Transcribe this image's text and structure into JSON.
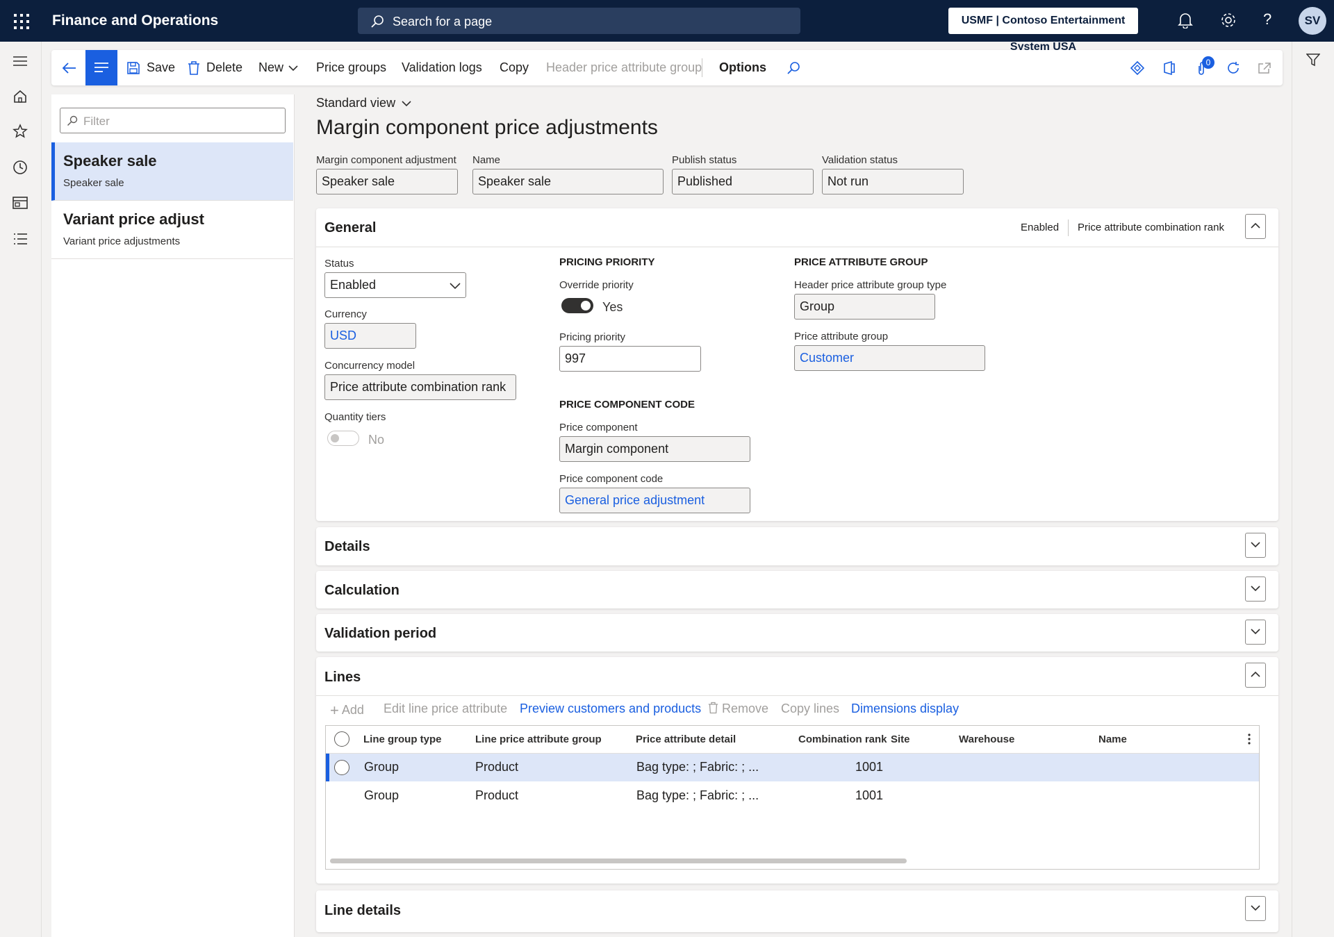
{
  "topbar": {
    "app_title": "Finance and Operations",
    "search_placeholder": "Search for a page",
    "company": "USMF | Contoso Entertainment System USA",
    "avatar_initials": "SV"
  },
  "actionbar": {
    "save": "Save",
    "delete": "Delete",
    "new": "New",
    "price_groups": "Price groups",
    "validation_logs": "Validation logs",
    "copy": "Copy",
    "header_price_attribute_group": "Header price attribute group",
    "options": "Options",
    "notification_count": "0"
  },
  "listpane": {
    "filter_placeholder": "Filter",
    "items": [
      {
        "title": "Speaker sale",
        "subtitle": "Speaker sale"
      },
      {
        "title": "Variant price adjust",
        "subtitle": "Variant price adjustments"
      }
    ]
  },
  "header": {
    "view": "Standard view",
    "title": "Margin component price adjustments",
    "fields": [
      {
        "label": "Margin component adjustment",
        "value": "Speaker sale"
      },
      {
        "label": "Name",
        "value": "Speaker sale"
      },
      {
        "label": "Publish status",
        "value": "Published"
      },
      {
        "label": "Validation status",
        "value": "Not run"
      }
    ]
  },
  "general": {
    "title": "General",
    "summary_status": "Enabled",
    "summary_concurrency": "Price attribute combination rank",
    "status_label": "Status",
    "status_value": "Enabled",
    "currency_label": "Currency",
    "currency_value": "USD",
    "concurrency_label": "Concurrency model",
    "concurrency_value": "Price attribute combination rank",
    "quantity_tiers_label": "Quantity tiers",
    "quantity_tiers_value": "No",
    "pricing_priority_header": "PRICING PRIORITY",
    "override_priority_label": "Override priority",
    "override_priority_value": "Yes",
    "pricing_priority_label": "Pricing priority",
    "pricing_priority_value": "997",
    "price_component_code_header": "PRICE COMPONENT CODE",
    "price_component_label": "Price component",
    "price_component_value": "Margin component",
    "price_component_code_label": "Price component code",
    "price_component_code_value": "General price adjustment",
    "price_attribute_group_header": "PRICE ATTRIBUTE GROUP",
    "header_group_type_label": "Header price attribute group type",
    "header_group_type_value": "Group",
    "price_attribute_group_label": "Price attribute group",
    "price_attribute_group_value": "Customer"
  },
  "sections": {
    "details": "Details",
    "calculation": "Calculation",
    "validation_period": "Validation period",
    "lines": "Lines",
    "line_details": "Line details"
  },
  "lines": {
    "toolbar": {
      "add": "Add",
      "edit_line_price_attribute": "Edit line price attribute",
      "preview": "Preview customers and products",
      "remove": "Remove",
      "copy_lines": "Copy lines",
      "dimensions_display": "Dimensions display"
    },
    "columns": [
      "Line group type",
      "Line price attribute group",
      "Price attribute detail",
      "Combination rank",
      "Site",
      "Warehouse",
      "Name"
    ],
    "rows": [
      {
        "line_group_type": "Group",
        "line_price_attribute_group": "Product",
        "price_attribute_detail": "Bag type: ; Fabric: ; ...",
        "combination_rank": "1001"
      },
      {
        "line_group_type": "Group",
        "line_price_attribute_group": "Product",
        "price_attribute_detail": "Bag type: ; Fabric: ; ...",
        "combination_rank": "1001"
      }
    ]
  },
  "colors": {
    "topbar": "#0c1f3d",
    "accent": "#1a5fe0",
    "selected_row": "#dde6f8"
  }
}
